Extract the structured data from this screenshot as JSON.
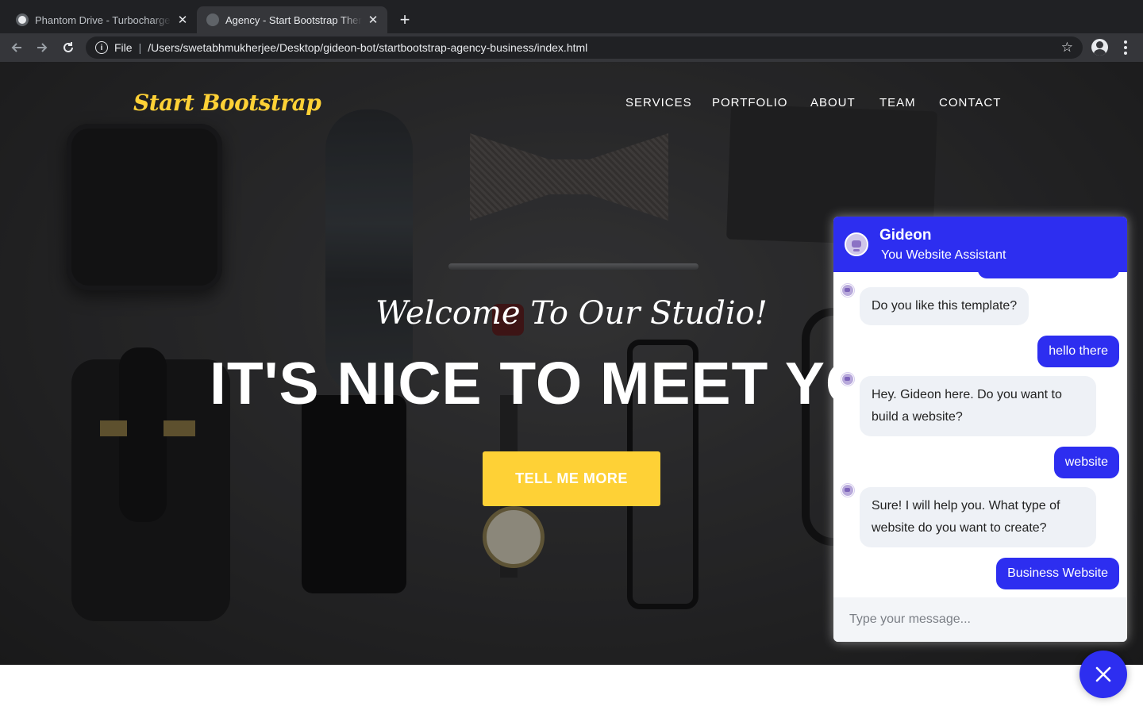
{
  "browser": {
    "tabs": [
      {
        "title": "Phantom Drive - Turbocharge y",
        "active": false
      },
      {
        "title": "Agency - Start Bootstrap Them",
        "active": true
      }
    ],
    "address": {
      "scheme": "File",
      "url": "/Users/swetabhmukherjee/Desktop/gideon-bot/startbootstrap-agency-business/index.html"
    }
  },
  "site": {
    "brand": "Start Bootstrap",
    "nav": [
      "SERVICES",
      "PORTFOLIO",
      "ABOUT",
      "TEAM",
      "CONTACT"
    ],
    "subheading": "Welcome To Our Studio!",
    "heading": "IT'S NICE TO MEET YOU",
    "cta": "TELL ME MORE"
  },
  "chat": {
    "name": "Gideon",
    "subtitle": "You Website Assistant",
    "messages": [
      {
        "from": "bot",
        "text": "Do you like this template?"
      },
      {
        "from": "user",
        "text": "hello there"
      },
      {
        "from": "bot",
        "text": "Hey. Gideon here. Do you want to build a website?"
      },
      {
        "from": "user",
        "text": "website"
      },
      {
        "from": "bot",
        "text": "Sure! I will help you. What type of website do you want to create?"
      },
      {
        "from": "user",
        "text": "Business Website"
      }
    ],
    "input_placeholder": "Type your message..."
  },
  "colors": {
    "accent": "#fed136",
    "chat_primary": "#2d2ef0",
    "chrome_dark": "#202124"
  },
  "icons": [
    "back-icon",
    "forward-icon",
    "reload-icon",
    "info-icon",
    "star-icon",
    "profile-icon",
    "menu-icon",
    "close-icon"
  ]
}
